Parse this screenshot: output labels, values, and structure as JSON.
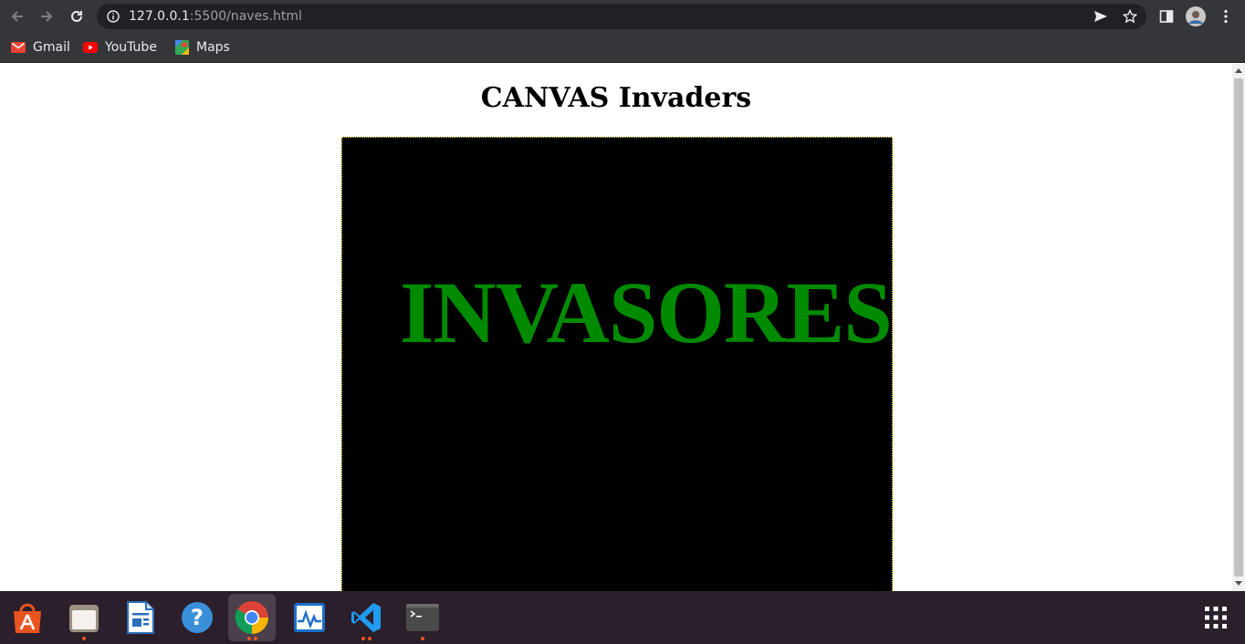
{
  "browser": {
    "url_host": "127.0.0.1",
    "url_path": ":5500/naves.html",
    "bookmarks": [
      {
        "label": "Gmail",
        "icon": "gmail-icon"
      },
      {
        "label": "YouTube",
        "icon": "youtube-icon"
      },
      {
        "label": "Maps",
        "icon": "maps-icon"
      }
    ]
  },
  "page": {
    "title": "CANVAS Invaders",
    "canvas_text": "INVASORES"
  },
  "colors": {
    "canvas_bg": "#000000",
    "canvas_text": "#008a00",
    "canvas_border": "#ffeb3b",
    "toolbar": "#35363a",
    "taskbar": "#2b1f2b"
  },
  "taskbar": {
    "apps": [
      "ubuntu-software-icon",
      "files-icon",
      "writer-icon",
      "help-icon",
      "chrome-icon",
      "system-monitor-icon",
      "vscode-icon",
      "terminal-icon",
      "show-apps-icon"
    ]
  }
}
